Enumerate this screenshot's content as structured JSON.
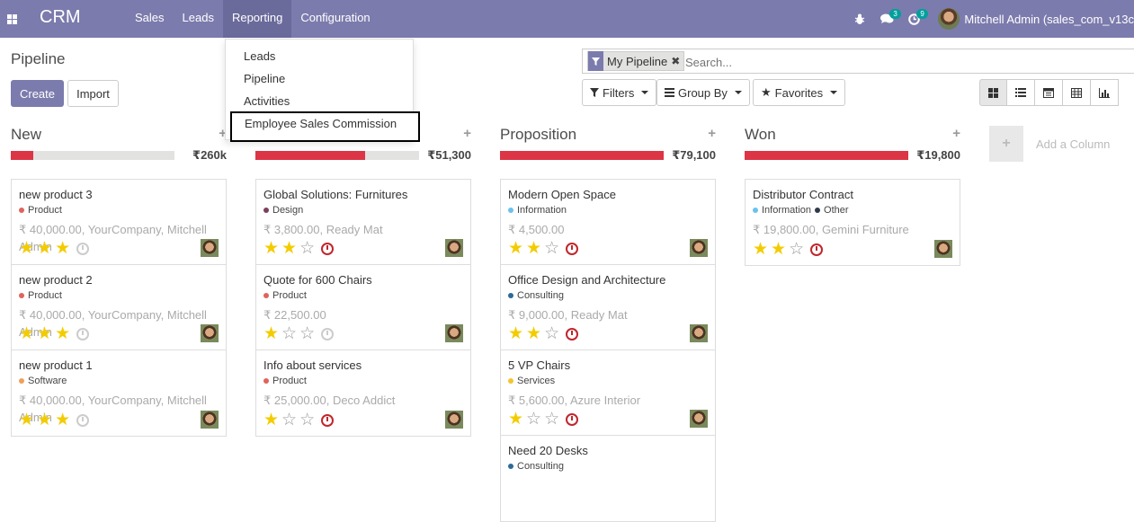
{
  "navbar": {
    "brand": "CRM",
    "menu": [
      "Sales",
      "Leads",
      "Reporting",
      "Configuration"
    ],
    "active_menu": "Reporting",
    "messages_count": "3",
    "activities_count": "9",
    "user": "Mitchell Admin (sales_com_v13c"
  },
  "reporting_dropdown": {
    "items": [
      "Leads",
      "Pipeline",
      "Activities",
      "Employee Sales Commission"
    ],
    "highlighted": "Employee Sales Commission"
  },
  "control_panel": {
    "title": "Pipeline",
    "create_label": "Create",
    "import_label": "Import",
    "search_facet": "My Pipeline",
    "search_placeholder": "Search...",
    "filters_label": "Filters",
    "group_by_label": "Group By",
    "favorites_label": "Favorites",
    "views": [
      "kanban",
      "list",
      "calendar",
      "pivot",
      "graph"
    ]
  },
  "columns": [
    {
      "title": "New",
      "total": "₹260k",
      "progress": 0.14,
      "cards": [
        {
          "name": "new product 3",
          "tags": [
            {
              "label": "Product",
              "color": "#e0635c"
            }
          ],
          "info": "₹ 40,000.00, YourCompany, Mitchell Admin",
          "stars": 3,
          "activity": "none"
        },
        {
          "name": "new product 2",
          "tags": [
            {
              "label": "Product",
              "color": "#e0635c"
            }
          ],
          "info": "₹ 40,000.00, YourCompany, Mitchell Admin",
          "stars": 3,
          "activity": "none"
        },
        {
          "name": "new product 1",
          "tags": [
            {
              "label": "Software",
              "color": "#f0a05a"
            }
          ],
          "info": "₹ 40,000.00, YourCompany, Mitchell Admin",
          "stars": 3,
          "activity": "none"
        }
      ]
    },
    {
      "title": "",
      "total": "₹51,300",
      "progress": 0.67,
      "cards": [
        {
          "name": "Global Solutions: Furnitures",
          "tags": [
            {
              "label": "Design",
              "color": "#7c3f5e"
            }
          ],
          "info": "₹ 3,800.00, Ready Mat",
          "stars": 2,
          "activity": "late"
        },
        {
          "name": "Quote for 600 Chairs",
          "tags": [
            {
              "label": "Product",
              "color": "#e0635c"
            }
          ],
          "info": "₹ 22,500.00",
          "stars": 1,
          "activity": "none"
        },
        {
          "name": "Info about services",
          "tags": [
            {
              "label": "Product",
              "color": "#e0635c"
            }
          ],
          "info": "₹ 25,000.00, Deco Addict",
          "stars": 1,
          "activity": "late"
        }
      ]
    },
    {
      "title": "Proposition",
      "total": "₹79,100",
      "progress": 1.0,
      "cards": [
        {
          "name": "Modern Open Space",
          "tags": [
            {
              "label": "Information",
              "color": "#6cc1ed"
            }
          ],
          "info": "₹ 4,500.00",
          "stars": 2,
          "activity": "late"
        },
        {
          "name": "Office Design and Architecture",
          "tags": [
            {
              "label": "Consulting",
              "color": "#2c6a9a"
            }
          ],
          "info": "₹ 9,000.00, Ready Mat",
          "stars": 2,
          "activity": "late"
        },
        {
          "name": "5 VP Chairs",
          "tags": [
            {
              "label": "Services",
              "color": "#f4c42e"
            }
          ],
          "info": "₹ 5,600.00, Azure Interior",
          "stars": 1,
          "activity": "late"
        },
        {
          "name": "Need 20 Desks",
          "tags": [
            {
              "label": "Consulting",
              "color": "#2c6a9a"
            }
          ],
          "info": "",
          "stars": 0,
          "activity": "none"
        }
      ]
    },
    {
      "title": "Won",
      "total": "₹19,800",
      "progress": 1.0,
      "cards": [
        {
          "name": "Distributor Contract",
          "tags": [
            {
              "label": "Information",
              "color": "#6cc1ed"
            },
            {
              "label": "Other",
              "color": "#2d3a4a"
            }
          ],
          "info": "₹ 19,800.00, Gemini Furniture",
          "stars": 2,
          "activity": "late"
        }
      ]
    }
  ],
  "add_column_label": "Add a Column"
}
